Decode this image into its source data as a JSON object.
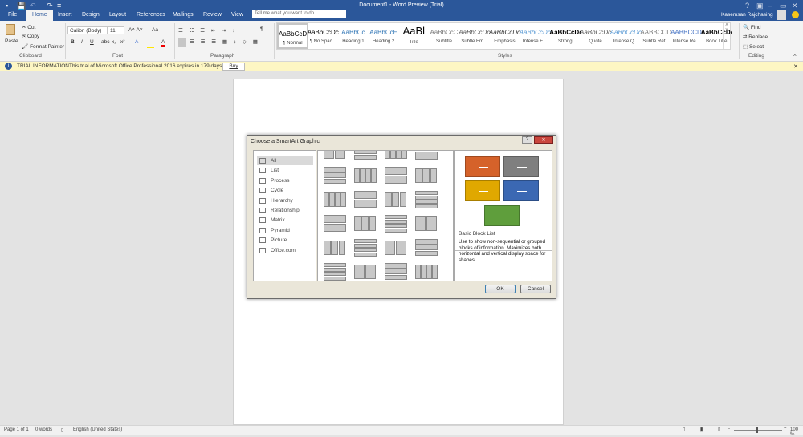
{
  "titlebar": {
    "title": "Document1 - Word Preview (Trial)",
    "user": "Kasemsan Rajchasing",
    "tell_me_placeholder": "Tell me what you want to do...",
    "help": "?",
    "min": "–",
    "restore": "▭",
    "close": "✕"
  },
  "tabs": [
    "File",
    "Home",
    "Insert",
    "Design",
    "Layout",
    "References",
    "Mailings",
    "Review",
    "View"
  ],
  "ribbon": {
    "clipboard": {
      "paste": "Paste",
      "cut": "Cut",
      "copy": "Copy",
      "format_painter": "Format Painter",
      "label": "Clipboard"
    },
    "font": {
      "name": "Calibri (Body)",
      "size": "11",
      "label": "Font",
      "bold": "B",
      "italic": "I",
      "underline": "U",
      "strike": "abc",
      "sub": "x₂",
      "sup": "x²",
      "case": "Aa"
    },
    "paragraph": {
      "label": "Paragraph",
      "pilcrow": "¶"
    },
    "styles": {
      "label": "Styles",
      "items": [
        {
          "preview": "AaBbCcDc",
          "name": "¶ Normal"
        },
        {
          "preview": "AaBbCcDc",
          "name": "¶ No Spac..."
        },
        {
          "preview": "AaBbCc",
          "name": "Heading 1"
        },
        {
          "preview": "AaBbCcE",
          "name": "Heading 2"
        },
        {
          "preview": "AaBl",
          "name": "Title"
        },
        {
          "preview": "AaBbCcC",
          "name": "Subtitle"
        },
        {
          "preview": "AaBbCcDc",
          "name": "Subtle Em..."
        },
        {
          "preview": "AaBbCcDc",
          "name": "Emphasis"
        },
        {
          "preview": "AaBbCcDc",
          "name": "Intense E..."
        },
        {
          "preview": "AaBbCcDc",
          "name": "Strong"
        },
        {
          "preview": "AaBbCcDc",
          "name": "Quote"
        },
        {
          "preview": "AaBbCcDc",
          "name": "Intense Q..."
        },
        {
          "preview": "AABBCCDC",
          "name": "Subtle Ref..."
        },
        {
          "preview": "AABBCCDC",
          "name": "Intense Re..."
        },
        {
          "preview": "AaBbCcDc",
          "name": "Book Title"
        }
      ]
    },
    "editing": {
      "label": "Editing",
      "find": "Find",
      "replace": "Replace",
      "select": "Select"
    }
  },
  "trial": {
    "label": "TRIAL INFORMATION",
    "message": "This trial of Microsoft Office Professional 2016 expires in 179 days.",
    "buy": "Buy",
    "close": "✕"
  },
  "dialog": {
    "title": "Choose a SmartArt Graphic",
    "help": "?",
    "close": "✕",
    "categories": [
      "All",
      "List",
      "Process",
      "Cycle",
      "Hierarchy",
      "Relationship",
      "Matrix",
      "Pyramid",
      "Picture",
      "Office.com"
    ],
    "selected_category": "All",
    "preview_title": "Basic Block List",
    "description": "Use to show non-sequential or grouped blocks of information. Maximizes both horizontal and vertical display space for shapes.",
    "ok": "OK",
    "cancel": "Cancel",
    "block_colors": [
      "#d5622a",
      "#7f7f7f",
      "#e0a800",
      "#3b68b3",
      "#5f9e3c"
    ]
  },
  "status": {
    "page": "Page 1 of 1",
    "words": "0 words",
    "language": "English (United States)",
    "zoom": "100 %"
  }
}
